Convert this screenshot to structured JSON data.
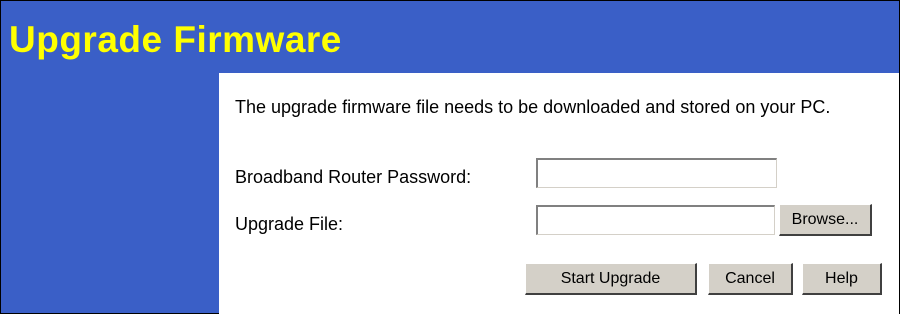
{
  "page": {
    "title": "Upgrade Firmware",
    "description": "The upgrade firmware file needs to be downloaded and stored on your PC."
  },
  "form": {
    "password_label": "Broadband Router Password:",
    "password_value": "",
    "file_label": "Upgrade File:",
    "file_value": "",
    "browse_label": "Browse...",
    "start_label": "Start Upgrade",
    "cancel_label": "Cancel",
    "help_label": "Help"
  },
  "colors": {
    "background": "#3a5fc7",
    "title": "#ffff00",
    "panel": "#ffffff",
    "button": "#d4d0c8"
  }
}
